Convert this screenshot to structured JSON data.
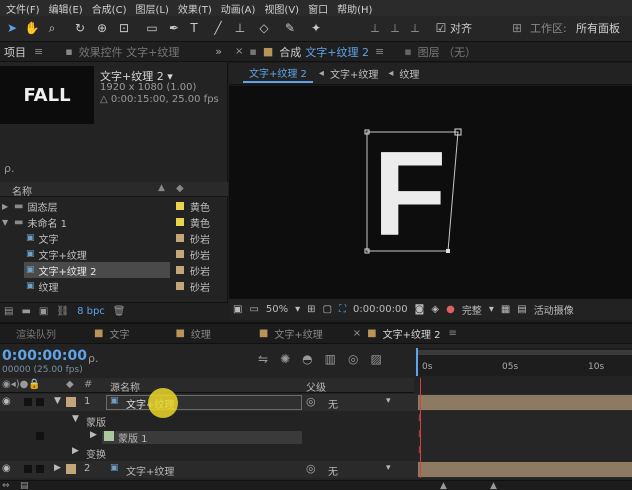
{
  "menu": [
    "文件(F)",
    "编辑(E)",
    "合成(C)",
    "图层(L)",
    "效果(T)",
    "动画(A)",
    "视图(V)",
    "窗口",
    "帮助(H)"
  ],
  "toolbar": {
    "snap_label": "对齐",
    "workspace_label": "工作区:",
    "workspace_value": "所有面板"
  },
  "project_panel": {
    "tab_project": "项目",
    "tab_effects": "效果控件 文字+纹理",
    "comp_name": "文字+纹理 2 ▾",
    "comp_size": "1920 x 1080 (1.00)",
    "comp_duration": "△ 0:00:15:00, 25.00 fps",
    "thumb_text": "FALL",
    "search_placeholder": "ρ.",
    "col_name": "名称",
    "bpc": "8 bpc",
    "items": [
      {
        "name": "固态层",
        "label": "黄色",
        "color": "#e8d44d"
      },
      {
        "name": "未命名 1",
        "label": "黄色",
        "color": "#e8d44d"
      },
      {
        "name": "文字",
        "label": "砂岩",
        "color": "#c4a67a"
      },
      {
        "name": "文字+纹理",
        "label": "砂岩",
        "color": "#c4a67a"
      },
      {
        "name": "文字+纹理 2",
        "label": "砂岩",
        "color": "#c4a67a"
      },
      {
        "name": "纹理",
        "label": "砂岩",
        "color": "#c4a67a"
      }
    ]
  },
  "comp_panel": {
    "tab_comp_prefix": "合成",
    "tab_comp_name": "文字+纹理 2",
    "tab_layer": "图层 （无）",
    "breadcrumb": [
      "文字+纹理 2",
      "文字+纹理",
      "纹理"
    ],
    "letter": "F",
    "zoom": "50%",
    "timecode": "0:00:00:00",
    "quality": "完整",
    "camera": "活动摄像"
  },
  "timeline": {
    "tabs": [
      "渲染队列",
      "文字",
      "纹理",
      "文字+纹理",
      "文字+纹理 2"
    ],
    "timecode": "0:00:00:00",
    "frames": "00000 (25.00 fps)",
    "search_placeholder": "ρ.",
    "col_hash": "#",
    "col_source": "源名称",
    "col_parent": "父级",
    "ruler": [
      "0s",
      "05s",
      "10s"
    ],
    "layers": [
      {
        "num": "1",
        "name": "文字+纹理",
        "parent": "无"
      },
      {
        "num": "2",
        "name": "文字+纹理",
        "parent": "无"
      }
    ],
    "mask_group": "蒙版",
    "mask_name": "蒙版 1",
    "transform": "变换"
  }
}
